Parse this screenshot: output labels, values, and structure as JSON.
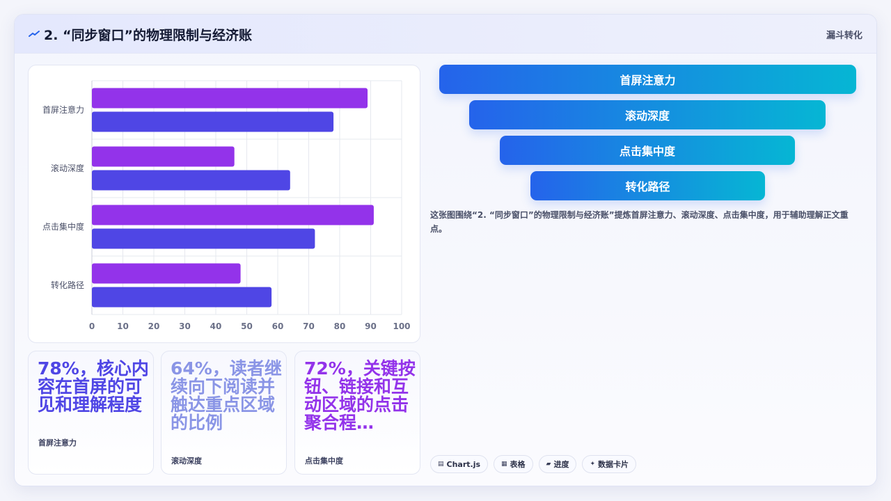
{
  "header": {
    "title": "2. “同步窗口”的物理限制与经济账",
    "tag": "漏斗转化"
  },
  "colors": {
    "series_primary": "#9333ea",
    "series_secondary": "#4f46e5",
    "funnel_start": "#2563eb",
    "funnel_end": "#06b6d4"
  },
  "chart_data": {
    "type": "bar",
    "orientation": "horizontal",
    "categories": [
      "首屏注意力",
      "滚动深度",
      "点击集中度",
      "转化路径"
    ],
    "series": [
      {
        "values": [
          89,
          46,
          91,
          48
        ]
      },
      {
        "values": [
          78,
          64,
          72,
          58
        ]
      }
    ],
    "xlim": [
      0,
      100
    ],
    "xticks": [
      0,
      10,
      20,
      30,
      40,
      50,
      60,
      70,
      80,
      90,
      100
    ],
    "grid": true
  },
  "stats": [
    {
      "value": "78%，核心内容在首屏的可见和理解程度",
      "label": "首屏注意力",
      "color": "#4f46e5"
    },
    {
      "value": "64%，读者继续向下阅读并触达重点区域的比例",
      "label": "滚动深度",
      "color": "#8a95e6"
    },
    {
      "value": "72%，关键按钮、链接和互动区域的点击聚合程…",
      "label": "点击集中度",
      "color": "#9333ea"
    }
  ],
  "funnel": [
    "首屏注意力",
    "滚动深度",
    "点击集中度",
    "转化路径"
  ],
  "summary": "这张图围绕“2. “同步窗口”的物理限制与经济账”提炼首屏注意力、滚动深度、点击集中度，用于辅助理解正文重点。",
  "tags": [
    {
      "icon": "chart-icon",
      "glyph": "▤",
      "label": "Chart.js"
    },
    {
      "icon": "table-icon",
      "glyph": "▦",
      "label": "表格"
    },
    {
      "icon": "progress-icon",
      "glyph": "▰",
      "label": "进度"
    },
    {
      "icon": "sparkle-icon",
      "glyph": "✦",
      "label": "数据卡片"
    }
  ]
}
